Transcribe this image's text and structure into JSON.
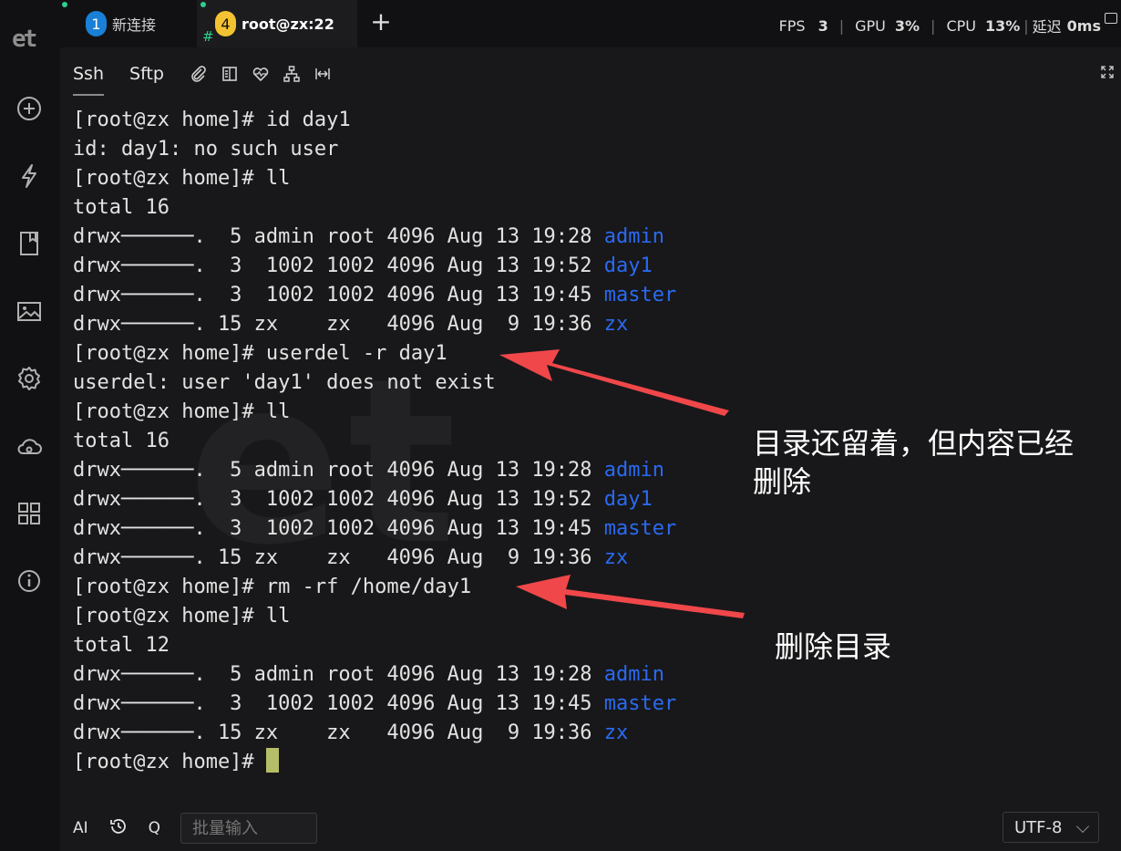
{
  "tabs": [
    {
      "number": "1",
      "label": "新连接"
    },
    {
      "number": "4",
      "label": "root@zx:22",
      "hash": "#"
    }
  ],
  "add_tab_label": "+",
  "stats": {
    "fps_label": "FPS",
    "fps_value": "3",
    "gpu_label": "GPU",
    "gpu_value": "3%",
    "cpu_label": "CPU",
    "cpu_value": "13%",
    "latency_label": "延迟",
    "latency_value": "0ms"
  },
  "logo": "et",
  "subtabs": [
    "Ssh",
    "Sftp"
  ],
  "sidebar_icons": [
    "plus-circle-icon",
    "lightning-icon",
    "bookmark-icon",
    "image-icon",
    "gear-icon",
    "cloud-icon",
    "grid-icon",
    "info-icon"
  ],
  "toolbar_icons": [
    "paperclip-icon",
    "split-icon",
    "heart-rate-icon",
    "sitemap-icon",
    "width-icon"
  ],
  "watermark": "et",
  "terminal_lines": [
    {
      "text": "[root@zx home]# id day1"
    },
    {
      "text": "id: day1: no such user"
    },
    {
      "text": "[root@zx home]# ll"
    },
    {
      "text": "total 16"
    },
    {
      "text": "drwx──────.  5 admin root 4096 Aug 13 19:28 ",
      "dir": "admin"
    },
    {
      "text": "drwx──────.  3  1002 1002 4096 Aug 13 19:52 ",
      "dir": "day1"
    },
    {
      "text": "drwx──────.  3  1002 1002 4096 Aug 13 19:45 ",
      "dir": "master"
    },
    {
      "text": "drwx──────. 15 zx    zx   4096 Aug  9 19:36 ",
      "dir": "zx"
    },
    {
      "text": "[root@zx home]# userdel -r day1"
    },
    {
      "text": "userdel: user 'day1' does not exist"
    },
    {
      "text": "[root@zx home]# ll"
    },
    {
      "text": "total 16"
    },
    {
      "text": "drwx──────.  5 admin root 4096 Aug 13 19:28 ",
      "dir": "admin"
    },
    {
      "text": "drwx──────.  3  1002 1002 4096 Aug 13 19:52 ",
      "dir": "day1"
    },
    {
      "text": "drwx──────.  3  1002 1002 4096 Aug 13 19:45 ",
      "dir": "master"
    },
    {
      "text": "drwx──────. 15 zx    zx   4096 Aug  9 19:36 ",
      "dir": "zx"
    },
    {
      "text": "[root@zx home]# rm -rf /home/day1"
    },
    {
      "text": "[root@zx home]# ll"
    },
    {
      "text": "total 12"
    },
    {
      "text": "drwx──────.  5 admin root 4096 Aug 13 19:28 ",
      "dir": "admin"
    },
    {
      "text": "drwx──────.  3  1002 1002 4096 Aug 13 19:45 ",
      "dir": "master"
    },
    {
      "text": "drwx──────. 15 zx    zx   4096 Aug  9 19:36 ",
      "dir": "zx"
    },
    {
      "text": "[root@zx home]# ",
      "cursor": true
    }
  ],
  "annotations": {
    "note1_line1": "目录还留着，但内容已经",
    "note1_line2": "删除",
    "note2": "删除目录"
  },
  "bottom": {
    "ai_label": "AI",
    "q_label": "Q",
    "batch_placeholder": "批量输入",
    "encoding": "UTF-8"
  },
  "colors": {
    "directory": "#2a6af2",
    "cursor": "#b5bd68",
    "arrow": "#f0474a",
    "tab_active_badge": "#f3c232",
    "tab_badge": "#1a7fd6"
  }
}
